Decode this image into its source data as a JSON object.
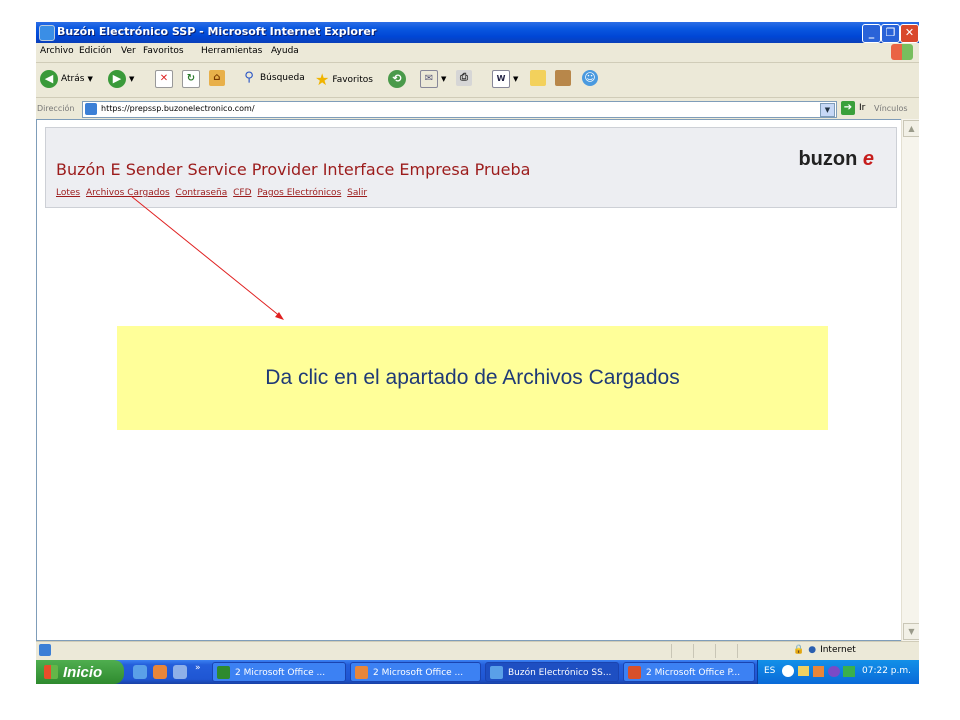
{
  "window": {
    "title": "Buzón Electrónico SSP - Microsoft Internet Explorer"
  },
  "menu": [
    "Archivo",
    "Edición",
    "Ver",
    "Favoritos",
    "Herramientas",
    "Ayuda"
  ],
  "toolbar": {
    "back_label": "Atrás",
    "search_label": "Búsqueda",
    "favorites_label": "Favoritos"
  },
  "address": {
    "label": "Dirección",
    "url": "https://prepssp.buzonelectronico.com/",
    "go_label": "Ir",
    "links_label": "Vínculos"
  },
  "page": {
    "title": "Buzón E Sender Service Provider Interface Empresa Prueba",
    "logo_text": "buzon",
    "logo_accent": "e",
    "nav": [
      "Lotes",
      "Archivos Cargados",
      "Contraseña",
      "CFD",
      "Pagos Electrónicos",
      "Salir"
    ]
  },
  "statusbar": {
    "zone": "Internet"
  },
  "taskbar": {
    "start_label": "Inicio",
    "tasks": [
      "2 Microsoft Office ...",
      "2 Microsoft Office ...",
      "Buzón Electrónico SS...",
      "2 Microsoft Office P..."
    ],
    "lang": "ES",
    "clock": "07:22 p.m."
  },
  "annotation": {
    "text": "Da clic en el apartado de Archivos Cargados"
  },
  "colors": {
    "title_red": "#9c1c1c",
    "note_bg": "#ffff99",
    "note_text": "#1f3a77",
    "arrow": "#e02020"
  }
}
